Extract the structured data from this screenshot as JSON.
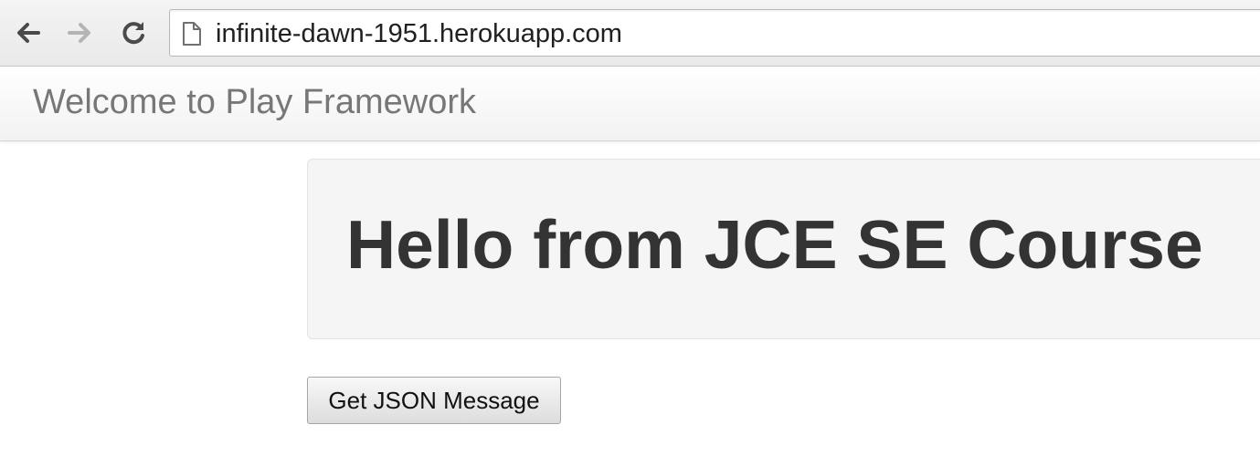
{
  "browser": {
    "url": "infinite-dawn-1951.herokuapp.com",
    "back_icon": "back-arrow-icon",
    "forward_icon": "forward-arrow-icon",
    "reload_icon": "reload-icon",
    "page_icon": "page-icon"
  },
  "navbar": {
    "brand": "Welcome to Play Framework"
  },
  "hero": {
    "title": "Hello from JCE SE Course"
  },
  "actions": {
    "get_json_label": "Get JSON Message"
  }
}
